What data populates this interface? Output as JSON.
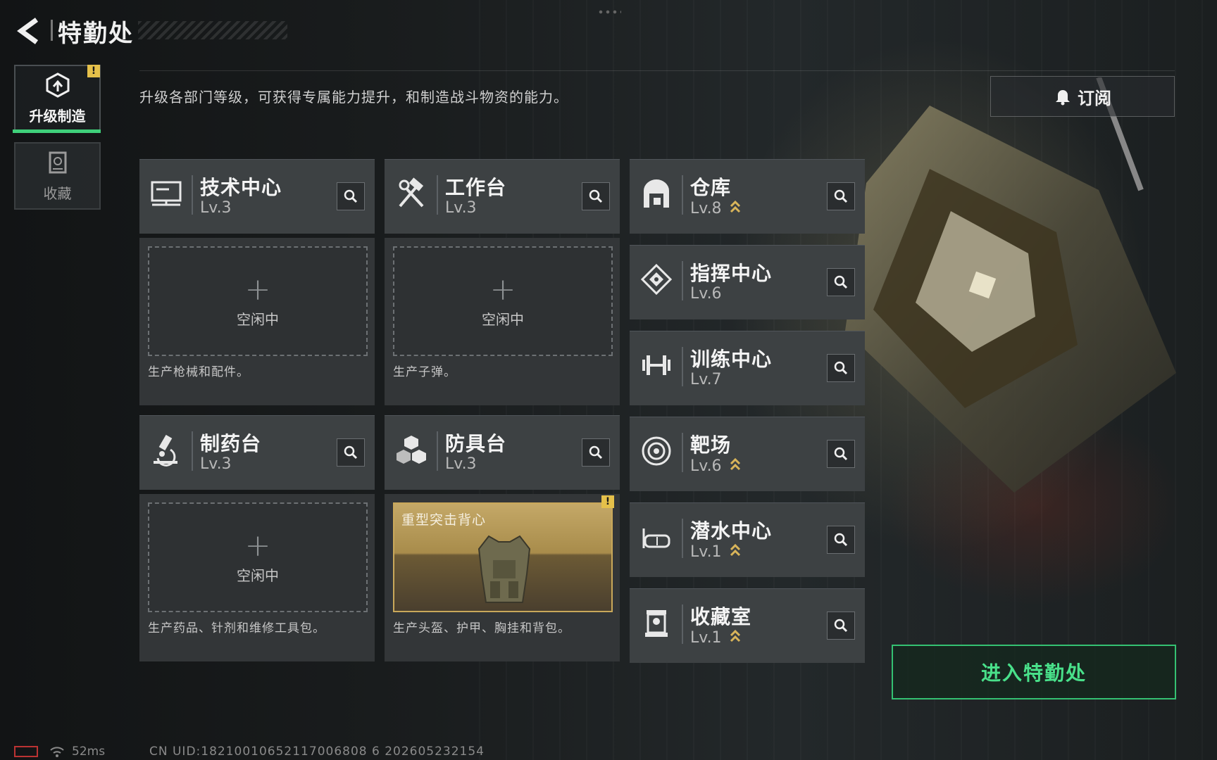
{
  "header": {
    "title": "特勤处"
  },
  "nav": [
    {
      "label": "升级制造",
      "icon": "upgrade-icon",
      "active": true,
      "warning": "!"
    },
    {
      "label": "收藏",
      "icon": "collection-icon",
      "active": false
    }
  ],
  "description": "升级各部门等级，可获得专属能力提升，和制造战斗物资的能力。",
  "subscribe": {
    "label": "订阅",
    "icon": "bell-icon"
  },
  "production_stations": [
    {
      "name": "技术中心",
      "level": "Lv.3",
      "icon": "computer-icon",
      "slot_state": "空闲中",
      "slot_plus": "+",
      "description": "生产枪械和配件。"
    },
    {
      "name": "工作台",
      "level": "Lv.3",
      "icon": "hammer-wrench-icon",
      "slot_state": "空闲中",
      "slot_plus": "+",
      "description": "生产子弹。"
    },
    {
      "name": "制药台",
      "level": "Lv.3",
      "icon": "microscope-icon",
      "slot_state": "空闲中",
      "slot_plus": "+",
      "description": "生产药品、针剂和维修工具包。"
    },
    {
      "name": "防具台",
      "level": "Lv.3",
      "icon": "cubes-icon",
      "slot_item": "重型突击背心",
      "slot_warning": "!",
      "description": "生产头盔、护甲、胸挂和背包。"
    }
  ],
  "facilities": [
    {
      "name": "仓库",
      "level": "Lv.8",
      "icon": "warehouse-icon",
      "upgradable": true
    },
    {
      "name": "指挥中心",
      "level": "Lv.6",
      "icon": "command-chip-icon",
      "upgradable": false
    },
    {
      "name": "训练中心",
      "level": "Lv.7",
      "icon": "dumbbell-icon",
      "upgradable": false
    },
    {
      "name": "靶场",
      "level": "Lv.6",
      "icon": "target-icon",
      "upgradable": true
    },
    {
      "name": "潜水中心",
      "level": "Lv.1",
      "icon": "diving-mask-icon",
      "upgradable": true
    },
    {
      "name": "收藏室",
      "level": "Lv.1",
      "icon": "trophy-case-icon",
      "upgradable": true
    }
  ],
  "enter_button": "进入特勤处",
  "footer": {
    "ping": "52ms",
    "uid": "CN UID:18210010652117006808 6 202605232154"
  },
  "colors": {
    "accent_green": "#49e08a",
    "warning_yellow": "#e5c04a",
    "upgrade_gold": "#d9b55a"
  }
}
